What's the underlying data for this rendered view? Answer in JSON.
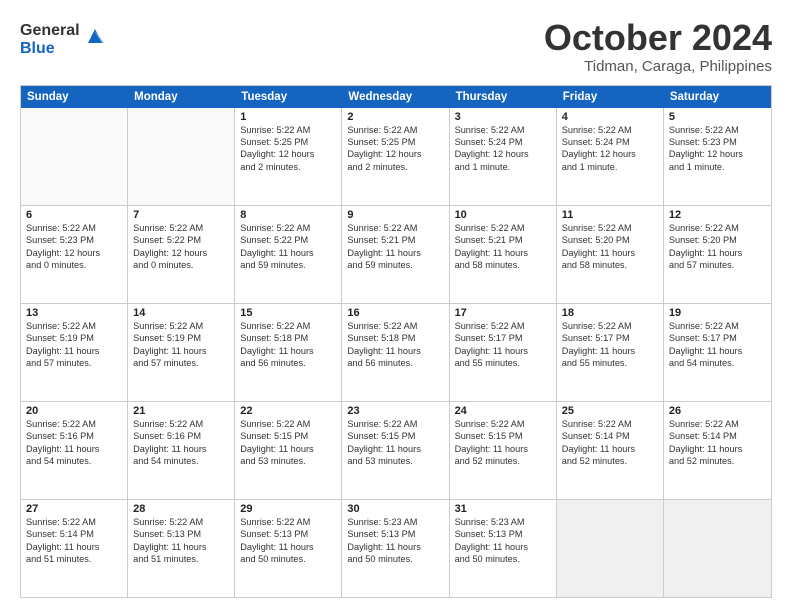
{
  "logo": {
    "general": "General",
    "blue": "Blue"
  },
  "title": "October 2024",
  "subtitle": "Tidman, Caraga, Philippines",
  "header_days": [
    "Sunday",
    "Monday",
    "Tuesday",
    "Wednesday",
    "Thursday",
    "Friday",
    "Saturday"
  ],
  "weeks": [
    [
      {
        "day": "",
        "lines": [],
        "empty": true
      },
      {
        "day": "",
        "lines": [],
        "empty": true
      },
      {
        "day": "1",
        "lines": [
          "Sunrise: 5:22 AM",
          "Sunset: 5:25 PM",
          "Daylight: 12 hours",
          "and 2 minutes."
        ]
      },
      {
        "day": "2",
        "lines": [
          "Sunrise: 5:22 AM",
          "Sunset: 5:25 PM",
          "Daylight: 12 hours",
          "and 2 minutes."
        ]
      },
      {
        "day": "3",
        "lines": [
          "Sunrise: 5:22 AM",
          "Sunset: 5:24 PM",
          "Daylight: 12 hours",
          "and 1 minute."
        ]
      },
      {
        "day": "4",
        "lines": [
          "Sunrise: 5:22 AM",
          "Sunset: 5:24 PM",
          "Daylight: 12 hours",
          "and 1 minute."
        ]
      },
      {
        "day": "5",
        "lines": [
          "Sunrise: 5:22 AM",
          "Sunset: 5:23 PM",
          "Daylight: 12 hours",
          "and 1 minute."
        ]
      }
    ],
    [
      {
        "day": "6",
        "lines": [
          "Sunrise: 5:22 AM",
          "Sunset: 5:23 PM",
          "Daylight: 12 hours",
          "and 0 minutes."
        ]
      },
      {
        "day": "7",
        "lines": [
          "Sunrise: 5:22 AM",
          "Sunset: 5:22 PM",
          "Daylight: 12 hours",
          "and 0 minutes."
        ]
      },
      {
        "day": "8",
        "lines": [
          "Sunrise: 5:22 AM",
          "Sunset: 5:22 PM",
          "Daylight: 11 hours",
          "and 59 minutes."
        ]
      },
      {
        "day": "9",
        "lines": [
          "Sunrise: 5:22 AM",
          "Sunset: 5:21 PM",
          "Daylight: 11 hours",
          "and 59 minutes."
        ]
      },
      {
        "day": "10",
        "lines": [
          "Sunrise: 5:22 AM",
          "Sunset: 5:21 PM",
          "Daylight: 11 hours",
          "and 58 minutes."
        ]
      },
      {
        "day": "11",
        "lines": [
          "Sunrise: 5:22 AM",
          "Sunset: 5:20 PM",
          "Daylight: 11 hours",
          "and 58 minutes."
        ]
      },
      {
        "day": "12",
        "lines": [
          "Sunrise: 5:22 AM",
          "Sunset: 5:20 PM",
          "Daylight: 11 hours",
          "and 57 minutes."
        ]
      }
    ],
    [
      {
        "day": "13",
        "lines": [
          "Sunrise: 5:22 AM",
          "Sunset: 5:19 PM",
          "Daylight: 11 hours",
          "and 57 minutes."
        ]
      },
      {
        "day": "14",
        "lines": [
          "Sunrise: 5:22 AM",
          "Sunset: 5:19 PM",
          "Daylight: 11 hours",
          "and 57 minutes."
        ]
      },
      {
        "day": "15",
        "lines": [
          "Sunrise: 5:22 AM",
          "Sunset: 5:18 PM",
          "Daylight: 11 hours",
          "and 56 minutes."
        ]
      },
      {
        "day": "16",
        "lines": [
          "Sunrise: 5:22 AM",
          "Sunset: 5:18 PM",
          "Daylight: 11 hours",
          "and 56 minutes."
        ]
      },
      {
        "day": "17",
        "lines": [
          "Sunrise: 5:22 AM",
          "Sunset: 5:17 PM",
          "Daylight: 11 hours",
          "and 55 minutes."
        ]
      },
      {
        "day": "18",
        "lines": [
          "Sunrise: 5:22 AM",
          "Sunset: 5:17 PM",
          "Daylight: 11 hours",
          "and 55 minutes."
        ]
      },
      {
        "day": "19",
        "lines": [
          "Sunrise: 5:22 AM",
          "Sunset: 5:17 PM",
          "Daylight: 11 hours",
          "and 54 minutes."
        ]
      }
    ],
    [
      {
        "day": "20",
        "lines": [
          "Sunrise: 5:22 AM",
          "Sunset: 5:16 PM",
          "Daylight: 11 hours",
          "and 54 minutes."
        ]
      },
      {
        "day": "21",
        "lines": [
          "Sunrise: 5:22 AM",
          "Sunset: 5:16 PM",
          "Daylight: 11 hours",
          "and 54 minutes."
        ]
      },
      {
        "day": "22",
        "lines": [
          "Sunrise: 5:22 AM",
          "Sunset: 5:15 PM",
          "Daylight: 11 hours",
          "and 53 minutes."
        ]
      },
      {
        "day": "23",
        "lines": [
          "Sunrise: 5:22 AM",
          "Sunset: 5:15 PM",
          "Daylight: 11 hours",
          "and 53 minutes."
        ]
      },
      {
        "day": "24",
        "lines": [
          "Sunrise: 5:22 AM",
          "Sunset: 5:15 PM",
          "Daylight: 11 hours",
          "and 52 minutes."
        ]
      },
      {
        "day": "25",
        "lines": [
          "Sunrise: 5:22 AM",
          "Sunset: 5:14 PM",
          "Daylight: 11 hours",
          "and 52 minutes."
        ]
      },
      {
        "day": "26",
        "lines": [
          "Sunrise: 5:22 AM",
          "Sunset: 5:14 PM",
          "Daylight: 11 hours",
          "and 52 minutes."
        ]
      }
    ],
    [
      {
        "day": "27",
        "lines": [
          "Sunrise: 5:22 AM",
          "Sunset: 5:14 PM",
          "Daylight: 11 hours",
          "and 51 minutes."
        ]
      },
      {
        "day": "28",
        "lines": [
          "Sunrise: 5:22 AM",
          "Sunset: 5:13 PM",
          "Daylight: 11 hours",
          "and 51 minutes."
        ]
      },
      {
        "day": "29",
        "lines": [
          "Sunrise: 5:22 AM",
          "Sunset: 5:13 PM",
          "Daylight: 11 hours",
          "and 50 minutes."
        ]
      },
      {
        "day": "30",
        "lines": [
          "Sunrise: 5:23 AM",
          "Sunset: 5:13 PM",
          "Daylight: 11 hours",
          "and 50 minutes."
        ]
      },
      {
        "day": "31",
        "lines": [
          "Sunrise: 5:23 AM",
          "Sunset: 5:13 PM",
          "Daylight: 11 hours",
          "and 50 minutes."
        ]
      },
      {
        "day": "",
        "lines": [],
        "empty": true,
        "shaded": true
      },
      {
        "day": "",
        "lines": [],
        "empty": true,
        "shaded": true
      }
    ]
  ]
}
